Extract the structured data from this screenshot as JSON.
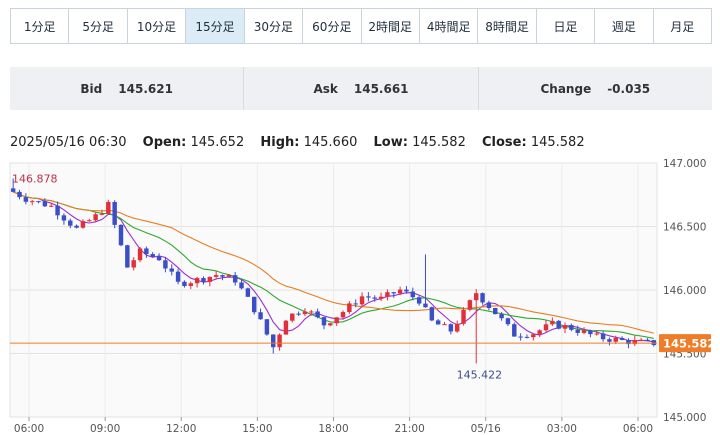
{
  "tabs": [
    {
      "label": "1分足",
      "active": false
    },
    {
      "label": "5分足",
      "active": false
    },
    {
      "label": "10分足",
      "active": false
    },
    {
      "label": "15分足",
      "active": true
    },
    {
      "label": "30分足",
      "active": false
    },
    {
      "label": "60分足",
      "active": false
    },
    {
      "label": "2時間足",
      "active": false
    },
    {
      "label": "4時間足",
      "active": false
    },
    {
      "label": "8時間足",
      "active": false
    },
    {
      "label": "日足",
      "active": false
    },
    {
      "label": "週足",
      "active": false
    },
    {
      "label": "月足",
      "active": false
    }
  ],
  "quote": {
    "bid_label": "Bid",
    "bid": "145.621",
    "ask_label": "Ask",
    "ask": "145.661",
    "change_label": "Change",
    "change": "-0.035"
  },
  "ohlc": {
    "datetime": "2025/05/16 06:30",
    "open_label": "Open:",
    "open": "145.652",
    "high_label": "High:",
    "high": "145.660",
    "low_label": "Low:",
    "low": "145.582",
    "close_label": "Close:",
    "close": "145.582"
  },
  "colors": {
    "up": "#e0303a",
    "down": "#3a4ec8",
    "ma_fast": "#9b30d0",
    "ma_mid": "#2ea82e",
    "ma_slow": "#e67e22",
    "last_price": "#f07c28"
  },
  "chart_data": {
    "type": "candlestick",
    "interval": "15分足",
    "ylim": [
      145.0,
      147.0
    ],
    "y_ticks": [
      "147.000",
      "146.500",
      "146.000",
      "145.500",
      "145.000"
    ],
    "x_ticks": [
      "06:00",
      "09:00",
      "12:00",
      "15:00",
      "18:00",
      "21:00",
      "05/16",
      "03:00",
      "06:00"
    ],
    "x_range": [
      "2025/05/15 05:15",
      "2025/05/16 06:45"
    ],
    "grid": true,
    "last_price": 145.582,
    "annotations": {
      "max": "146.878",
      "min": "145.422"
    },
    "moving_averages": [
      {
        "color": "purple"
      },
      {
        "color": "green"
      },
      {
        "color": "orange"
      }
    ],
    "close_path": [
      [
        "2025/05/15 05:15",
        146.8
      ],
      [
        "2025/05/15 06:00",
        146.72
      ],
      [
        "2025/05/15 07:00",
        146.66
      ],
      [
        "2025/05/15 08:00",
        146.48
      ],
      [
        "2025/05/15 08:45",
        146.58
      ],
      [
        "2025/05/15 09:15",
        146.67
      ],
      [
        "2025/05/15 10:00",
        146.18
      ],
      [
        "2025/05/15 10:30",
        146.3
      ],
      [
        "2025/05/15 11:15",
        146.25
      ],
      [
        "2025/05/15 12:00",
        146.05
      ],
      [
        "2025/05/15 12:45",
        146.08
      ],
      [
        "2025/05/15 13:30",
        146.12
      ],
      [
        "2025/05/15 14:15",
        146.08
      ],
      [
        "2025/05/15 15:00",
        145.85
      ],
      [
        "2025/05/15 15:45",
        145.55
      ],
      [
        "2025/05/15 16:15",
        145.78
      ],
      [
        "2025/05/15 17:00",
        145.86
      ],
      [
        "2025/05/15 17:45",
        145.73
      ],
      [
        "2025/05/15 18:30",
        145.83
      ],
      [
        "2025/05/15 19:15",
        145.95
      ],
      [
        "2025/05/15 20:00",
        145.93
      ],
      [
        "2025/05/15 20:45",
        146.0
      ],
      [
        "2025/05/15 21:30",
        145.92
      ],
      [
        "2025/05/15 22:00",
        145.75
      ],
      [
        "2025/05/15 22:45",
        145.68
      ],
      [
        "2025/05/15 23:15",
        145.82
      ],
      [
        "2025/05/15 23:45",
        145.98
      ],
      [
        "2025/05/16 00:30",
        145.82
      ],
      [
        "2025/05/16 01:15",
        145.65
      ],
      [
        "2025/05/16 02:00",
        145.66
      ],
      [
        "2025/05/16 02:45",
        145.73
      ],
      [
        "2025/05/16 03:30",
        145.7
      ],
      [
        "2025/05/16 04:30",
        145.63
      ],
      [
        "2025/05/16 05:30",
        145.6
      ],
      [
        "2025/05/16 06:30",
        145.582
      ]
    ]
  }
}
